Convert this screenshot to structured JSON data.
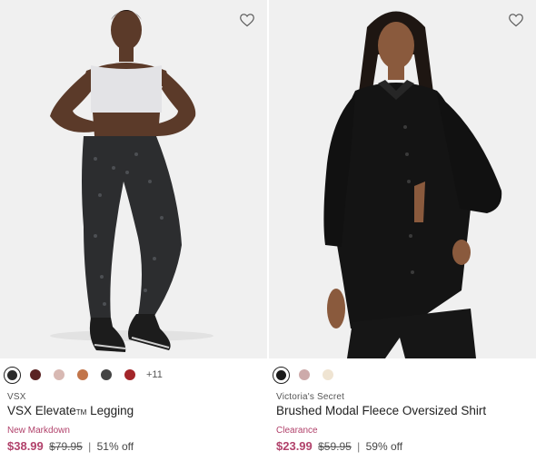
{
  "products": [
    {
      "brand": "VSX",
      "name": "VSX Elevate",
      "name_tm": "TM",
      "name_suffix": " Legging",
      "status": "New Markdown",
      "sale_price": "$38.99",
      "original_price": "$79.95",
      "discount": "51% off",
      "more_colors": "+11",
      "swatches": [
        "#2a2a2a",
        "#5a2323",
        "#d8b9b3",
        "#c2754a",
        "#444444",
        "#a3262a"
      ],
      "selected_swatch": 0,
      "image": "model-in-gray-bra-and-black-printed-leggings"
    },
    {
      "brand": "Victoria's Secret",
      "name": "Brushed Modal Fleece Oversized Shirt",
      "status": "Clearance",
      "sale_price": "$23.99",
      "original_price": "$59.95",
      "discount": "59% off",
      "swatches": [
        "#1a1a1a",
        "#cdaaaa",
        "#efe4d2"
      ],
      "selected_swatch": 0,
      "image": "model-in-black-oversized-shirt"
    }
  ],
  "icons": {
    "favorite": "heart-outline-icon"
  },
  "colors": {
    "sale": "#b1426b",
    "background": "#f0f0f0"
  }
}
